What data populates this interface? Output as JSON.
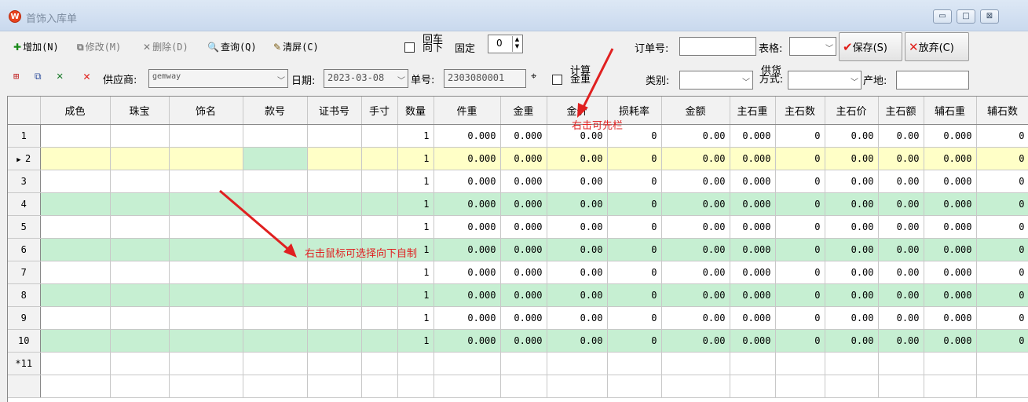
{
  "window": {
    "logo": "W",
    "title": "首饰入库单",
    "controls": [
      "▭",
      "□",
      "⊠"
    ]
  },
  "toolbar": {
    "add": "增加(N)",
    "modify": "修改(M)",
    "delete": "删除(D)",
    "query": "查询(Q)",
    "clear": "清屏(C)",
    "backfill_label": "回车向下",
    "fixed_label": "固定",
    "fixed_value": "0",
    "order_no_label": "订单号:",
    "order_no_value": "",
    "table_label": "表格:",
    "table_value": "",
    "save": "保存(S)",
    "discard": "放弃(C)"
  },
  "toolbar2": {
    "supplier_label": "供应商:",
    "supplier_value": "gemway",
    "date_label": "日期:",
    "date_value": "2023-03-08",
    "doc_no_label": "单号:",
    "doc_no_value": "2303080001",
    "calc_gold_label": "计算金重",
    "category_label": "类别:",
    "category_value": "",
    "supply_mode_label": "供货方式:",
    "supply_mode_value": "",
    "origin_label": "产地:",
    "origin_value": ""
  },
  "grid": {
    "columns": [
      "成色",
      "珠宝",
      "饰名",
      "款号",
      "证书号",
      "手寸",
      "数量",
      "件重",
      "金重",
      "金价",
      "损耗率",
      "金额",
      "主石重",
      "主石数",
      "主石价",
      "主石额",
      "辅石重",
      "辅石数"
    ],
    "rows": [
      {
        "id": "1",
        "style": "white",
        "values": [
          "",
          "",
          "",
          "",
          "",
          "",
          "1",
          "0.000",
          "0.000",
          "0.00",
          "0",
          "0.00",
          "0.000",
          "0",
          "0.00",
          "0.00",
          "0.000",
          "0"
        ]
      },
      {
        "id": "2",
        "style": "yellow",
        "current": true,
        "values": [
          "",
          "",
          "",
          "",
          "",
          "",
          "1",
          "0.000",
          "0.000",
          "0.00",
          "0",
          "0.00",
          "0.000",
          "0",
          "0.00",
          "0.00",
          "0.000",
          "0"
        ]
      },
      {
        "id": "3",
        "style": "white",
        "values": [
          "",
          "",
          "",
          "",
          "",
          "",
          "1",
          "0.000",
          "0.000",
          "0.00",
          "0",
          "0.00",
          "0.000",
          "0",
          "0.00",
          "0.00",
          "0.000",
          "0"
        ]
      },
      {
        "id": "4",
        "style": "green",
        "values": [
          "",
          "",
          "",
          "",
          "",
          "",
          "1",
          "0.000",
          "0.000",
          "0.00",
          "0",
          "0.00",
          "0.000",
          "0",
          "0.00",
          "0.00",
          "0.000",
          "0"
        ]
      },
      {
        "id": "5",
        "style": "white",
        "values": [
          "",
          "",
          "",
          "",
          "",
          "",
          "1",
          "0.000",
          "0.000",
          "0.00",
          "0",
          "0.00",
          "0.000",
          "0",
          "0.00",
          "0.00",
          "0.000",
          "0"
        ]
      },
      {
        "id": "6",
        "style": "green",
        "values": [
          "",
          "",
          "",
          "",
          "",
          "",
          "1",
          "0.000",
          "0.000",
          "0.00",
          "0",
          "0.00",
          "0.000",
          "0",
          "0.00",
          "0.00",
          "0.000",
          "0"
        ]
      },
      {
        "id": "7",
        "style": "white",
        "values": [
          "",
          "",
          "",
          "",
          "",
          "",
          "1",
          "0.000",
          "0.000",
          "0.00",
          "0",
          "0.00",
          "0.000",
          "0",
          "0.00",
          "0.00",
          "0.000",
          "0"
        ]
      },
      {
        "id": "8",
        "style": "green",
        "values": [
          "",
          "",
          "",
          "",
          "",
          "",
          "1",
          "0.000",
          "0.000",
          "0.00",
          "0",
          "0.00",
          "0.000",
          "0",
          "0.00",
          "0.00",
          "0.000",
          "0"
        ]
      },
      {
        "id": "9",
        "style": "white",
        "values": [
          "",
          "",
          "",
          "",
          "",
          "",
          "1",
          "0.000",
          "0.000",
          "0.00",
          "0",
          "0.00",
          "0.000",
          "0",
          "0.00",
          "0.00",
          "0.000",
          "0"
        ]
      },
      {
        "id": "10",
        "style": "green",
        "values": [
          "",
          "",
          "",
          "",
          "",
          "",
          "1",
          "0.000",
          "0.000",
          "0.00",
          "0",
          "0.00",
          "0.000",
          "0",
          "0.00",
          "0.00",
          "0.000",
          "0"
        ]
      },
      {
        "id": "*11",
        "style": "white",
        "values": [
          "",
          "",
          "",
          "",
          "",
          "",
          "",
          "",
          "",
          "",
          "",
          "",
          "",
          "",
          "",
          "",
          "",
          ""
        ]
      },
      {
        "id": "",
        "style": "white",
        "values": [
          "",
          "",
          "",
          "",
          "",
          "",
          "",
          "",
          "",
          "",
          "",
          "",
          "",
          "",
          "",
          "",
          "",
          ""
        ]
      }
    ]
  },
  "annotations": {
    "right_click_column": "右击可先栏",
    "right_click_fill": "右击鼠标可选择向下自制",
    "color": "#e02020"
  },
  "colors": {
    "row_green": "#c6efd2",
    "row_yellow": "#ffffc7",
    "accent_red": "#e0201b"
  }
}
